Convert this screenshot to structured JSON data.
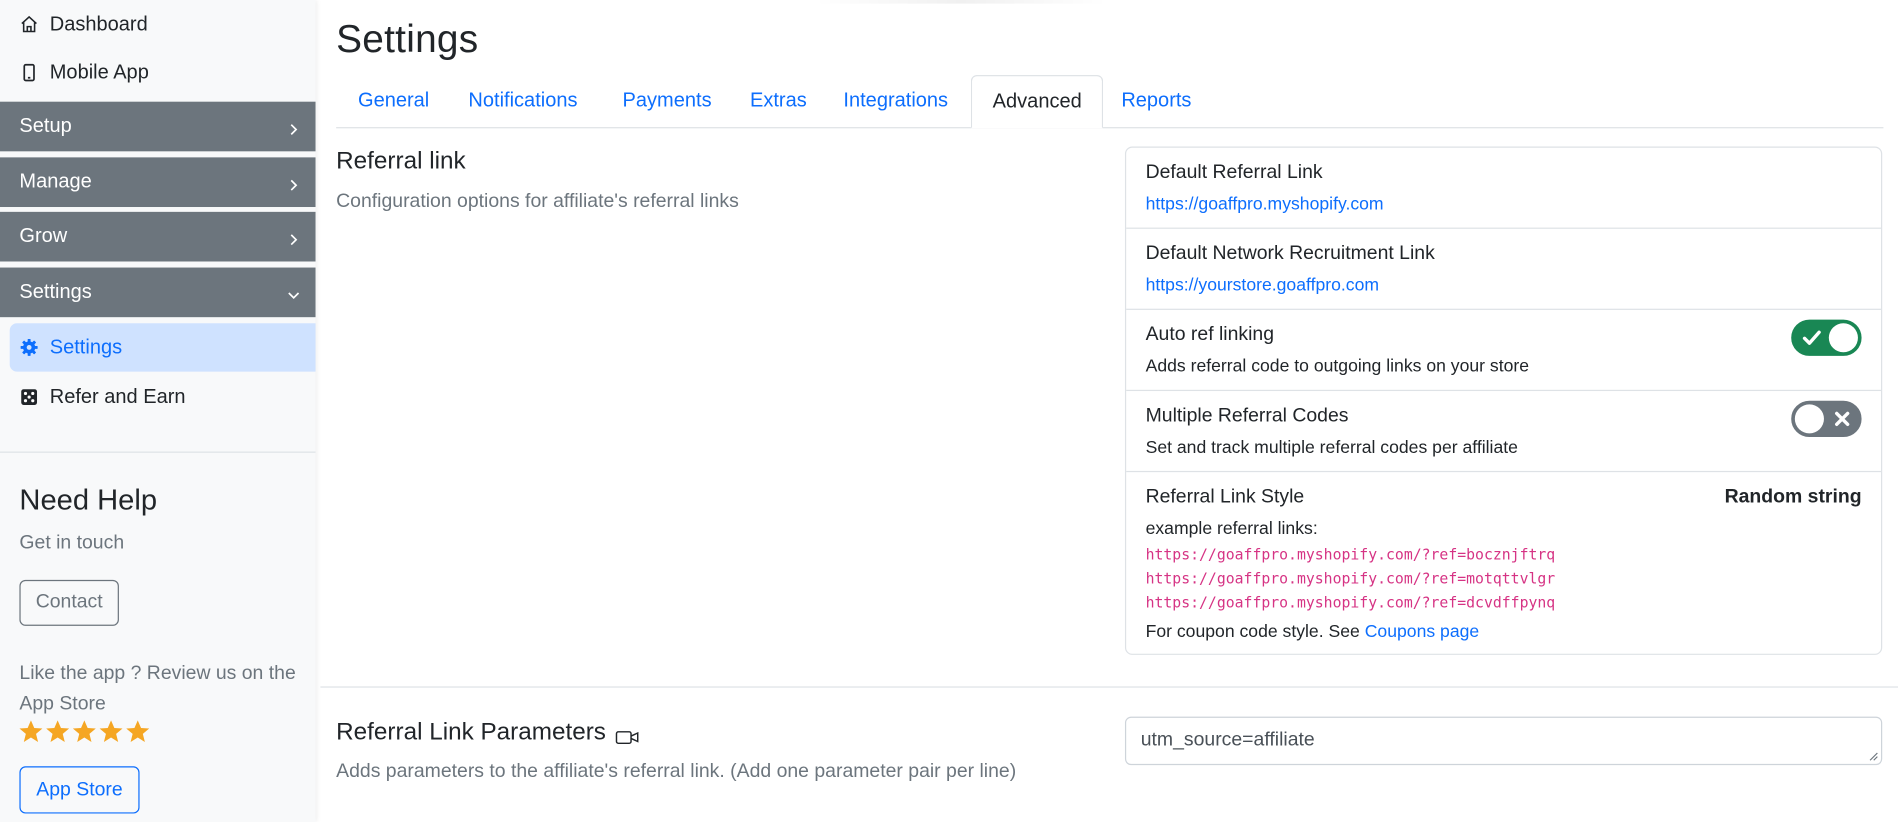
{
  "sidebar": {
    "top_items": [
      {
        "label": "Dashboard",
        "icon": "home-icon"
      },
      {
        "label": "Mobile App",
        "icon": "mobile-phone-icon"
      }
    ],
    "sections": [
      {
        "label": "Setup",
        "expanded": false
      },
      {
        "label": "Manage",
        "expanded": false
      },
      {
        "label": "Grow",
        "expanded": false
      },
      {
        "label": "Settings",
        "expanded": true
      }
    ],
    "settings_children": [
      {
        "label": "Settings",
        "icon": "gear-icon",
        "active": true
      },
      {
        "label": "Refer and Earn",
        "icon": "dice-icon",
        "active": false
      }
    ],
    "help": {
      "title": "Need Help",
      "subtitle": "Get in touch",
      "contact_button": "Contact",
      "review_text": "Like the app ? Review us on the App Store",
      "stars": 5,
      "app_store_button": "App Store"
    }
  },
  "main": {
    "title": "Settings",
    "tabs": [
      {
        "label": "General",
        "active": false
      },
      {
        "label": "Notifications",
        "active": false
      },
      {
        "label": "Payments",
        "active": false
      },
      {
        "label": "Extras",
        "active": false
      },
      {
        "label": "Integrations",
        "active": false
      },
      {
        "label": "Advanced",
        "active": true
      },
      {
        "label": "Reports",
        "active": false
      }
    ],
    "referral_link": {
      "title": "Referral link",
      "description": "Configuration options for affiliate's referral links",
      "items": {
        "default_link": {
          "title": "Default Referral Link",
          "value": "https://goaffpro.myshopify.com"
        },
        "network_link": {
          "title": "Default Network Recruitment Link",
          "value": "https://yourstore.goaffpro.com"
        },
        "auto_ref": {
          "title": "Auto ref linking",
          "description": "Adds referral code to outgoing links on your store",
          "enabled": true
        },
        "multiple_codes": {
          "title": "Multiple Referral Codes",
          "description": "Set and track multiple referral codes per affiliate",
          "enabled": false
        },
        "link_style": {
          "title": "Referral Link Style",
          "value": "Random string",
          "examples_label": "example referral links:",
          "examples": [
            "https://goaffpro.myshopify.com/?ref=bocznjftrq",
            "https://goaffpro.myshopify.com/?ref=motqttvlgr",
            "https://goaffpro.myshopify.com/?ref=dcvdffpynq"
          ],
          "coupon_note": "For coupon code style. See",
          "coupon_link": "Coupons page"
        }
      }
    },
    "parameters": {
      "title": "Referral Link Parameters",
      "title_icon": "video-camera-icon",
      "description": "Adds parameters to the affiliate's referral link. (Add one parameter pair per line)",
      "value": "utm_source=affiliate"
    }
  },
  "colors": {
    "primary": "#0d6efd",
    "section_bg": "#6c757d",
    "active_bg": "#cfe2ff",
    "toggle_on": "#198754",
    "toggle_off": "#6c757d",
    "code_pink": "#d63384",
    "star": "#f5a623"
  }
}
